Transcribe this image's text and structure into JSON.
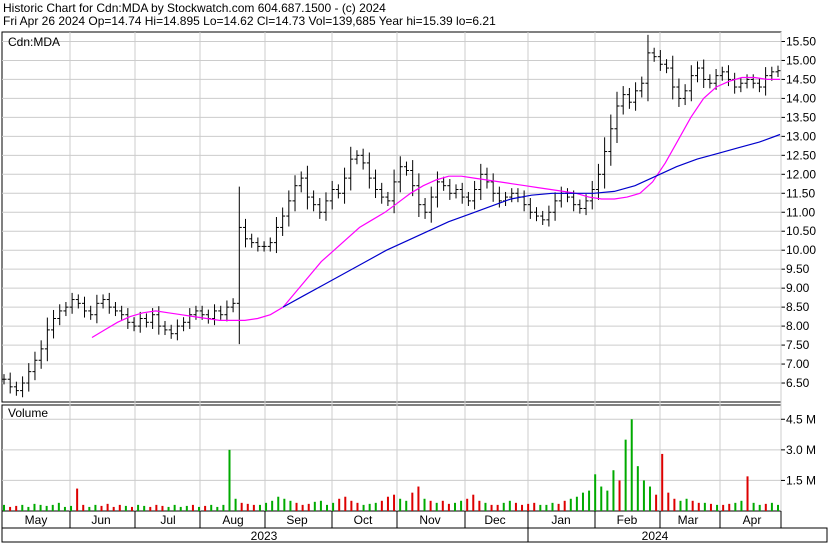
{
  "header": {
    "line1": "Historic Chart for Cdn:MDA by Stockwatch.com 604.687.1500 - (c) 2024",
    "line2": "Fri Apr 26 2024   Op=14.74   Hi=14.895   Lo=14.62   Cl=14.73   Vol=139,685   Year hi=15.39   lo=6.21"
  },
  "colors": {
    "price_bar": "#000000",
    "ma_short": "#ff00ff",
    "ma_long": "#0000cc",
    "vol_up": "#00aa00",
    "vol_down": "#dd0000",
    "grid": "#cccccc"
  },
  "chart_data": [
    {
      "type": "line",
      "panel": "price",
      "label": "Cdn:MDA",
      "ylim": [
        6.0,
        15.75
      ],
      "y_ticks": [
        "15.50",
        "15.00",
        "14.50",
        "14.00",
        "13.50",
        "13.00",
        "12.50",
        "12.00",
        "11.50",
        "11.00",
        "10.50",
        "10.00",
        "9.50",
        "9.00",
        "8.50",
        "8.00",
        "7.50",
        "7.00",
        "6.50"
      ],
      "x_months": [
        "May",
        "Jun",
        "Jul",
        "Aug",
        "Sep",
        "Oct",
        "Nov",
        "Dec",
        "Jan",
        "Feb",
        "Mar",
        "Apr"
      ],
      "x_years": [
        "2023",
        "2024"
      ],
      "series": [
        {
          "kind": "ohlc_close",
          "values": [
            6.6,
            6.4,
            6.3,
            6.5,
            6.8,
            7.1,
            7.4,
            7.9,
            8.2,
            8.4,
            8.5,
            8.7,
            8.6,
            8.4,
            8.3,
            8.6,
            8.7,
            8.5,
            8.4,
            8.3,
            8.1,
            8.0,
            8.2,
            8.1,
            8.3,
            8.0,
            7.9,
            7.8,
            8.0,
            8.1,
            8.3,
            8.4,
            8.3,
            8.2,
            8.4,
            8.3,
            8.5,
            8.6,
            10.6,
            10.3,
            10.2,
            10.1,
            10.1,
            10.2,
            10.6,
            10.9,
            11.3,
            11.7,
            11.9,
            11.4,
            11.2,
            11.0,
            11.3,
            11.6,
            11.5,
            11.9,
            12.4,
            12.5,
            12.3,
            11.9,
            11.6,
            11.4,
            11.3,
            11.8,
            12.2,
            12.1,
            11.7,
            11.2,
            11.0,
            11.4,
            11.8,
            11.7,
            11.5,
            11.6,
            11.4,
            11.3,
            11.6,
            12.0,
            11.8,
            11.5,
            11.3,
            11.4,
            11.5,
            11.4,
            11.2,
            11.0,
            10.9,
            10.8,
            11.0,
            11.3,
            11.5,
            11.4,
            11.2,
            11.1,
            11.3,
            11.6,
            12.0,
            12.6,
            13.2,
            13.8,
            14.1,
            13.9,
            14.2,
            14.4,
            15.2,
            15.1,
            14.9,
            14.8,
            14.3,
            14.0,
            14.2,
            14.6,
            14.8,
            14.5,
            14.4,
            14.6,
            14.7,
            14.5,
            14.3,
            14.4,
            14.5,
            14.4,
            14.3,
            14.6,
            14.7,
            14.73
          ]
        },
        {
          "name": "",
          "kind": "moving_average_short",
          "values": [
            7.7,
            7.9,
            8.1,
            8.25,
            8.35,
            8.4,
            8.35,
            8.3,
            8.25,
            8.2,
            8.15,
            8.15,
            8.15,
            8.2,
            8.3,
            8.5,
            8.9,
            9.3,
            9.7,
            10.0,
            10.3,
            10.6,
            10.8,
            11.0,
            11.25,
            11.5,
            11.7,
            11.85,
            11.95,
            11.95,
            11.9,
            11.85,
            11.8,
            11.75,
            11.7,
            11.65,
            11.6,
            11.55,
            11.5,
            11.4,
            11.35,
            11.35,
            11.4,
            11.5,
            11.8,
            12.3,
            12.9,
            13.5,
            14.0,
            14.3,
            14.45,
            14.55,
            14.55,
            14.5,
            14.5
          ]
        },
        {
          "name": "",
          "kind": "moving_average_long",
          "values": [
            8.5,
            8.8,
            9.1,
            9.4,
            9.7,
            10.0,
            10.25,
            10.5,
            10.75,
            10.95,
            11.15,
            11.35,
            11.45,
            11.5,
            11.5,
            11.5,
            11.55,
            11.7,
            11.95,
            12.2,
            12.4,
            12.55,
            12.7,
            12.85,
            13.05
          ]
        }
      ]
    },
    {
      "type": "bar",
      "panel": "volume",
      "label": "Volume",
      "ylim": [
        0,
        5.2
      ],
      "y_ticks": [
        "4.5 M",
        "3.0 M",
        "1.5 M"
      ],
      "values": [
        0.3,
        0.2,
        0.25,
        0.3,
        0.2,
        0.35,
        0.3,
        0.25,
        0.3,
        0.4,
        0.2,
        0.25,
        1.1,
        0.3,
        0.2,
        0.3,
        0.25,
        0.35,
        0.2,
        0.3,
        0.25,
        0.2,
        0.3,
        0.25,
        0.2,
        0.3,
        0.25,
        0.2,
        0.3,
        0.2,
        0.25,
        0.3,
        0.2,
        0.25,
        0.3,
        0.2,
        0.3,
        3.0,
        0.6,
        0.4,
        0.35,
        0.3,
        0.3,
        0.4,
        0.5,
        0.7,
        0.6,
        0.5,
        0.4,
        0.3,
        0.35,
        0.45,
        0.5,
        0.3,
        0.4,
        0.6,
        0.7,
        0.5,
        0.4,
        0.3,
        0.35,
        0.4,
        0.5,
        0.7,
        0.8,
        0.6,
        0.5,
        0.9,
        1.2,
        0.6,
        0.5,
        0.4,
        0.5,
        0.35,
        0.4,
        0.5,
        0.6,
        0.8,
        0.5,
        0.4,
        0.3,
        0.3,
        0.4,
        0.5,
        0.4,
        0.3,
        0.35,
        0.4,
        0.3,
        0.3,
        0.4,
        0.35,
        0.5,
        0.6,
        0.7,
        0.9,
        1.0,
        1.8,
        1.2,
        1.0,
        2.0,
        1.5,
        3.5,
        4.5,
        2.2,
        1.5,
        1.2,
        0.8,
        2.8,
        0.9,
        0.6,
        0.5,
        0.6,
        0.5,
        0.4,
        0.4,
        0.35,
        0.3,
        0.3,
        0.35,
        0.4,
        0.5,
        1.7,
        0.4,
        0.3,
        0.35,
        0.4,
        0.3
      ],
      "directions": "UDDUUUUUUUUUDDUUDDDDUDUUDDDUUUUDUDUUUUUDDDUUUUUUDDDUUUUDDDDUUUDDDUUDDUDUDDUUDDDUDDUUDDDDUUUDDUUUUUUUUDUUUUUDDDDUUDDUDUDDUUDUUD"
    }
  ]
}
